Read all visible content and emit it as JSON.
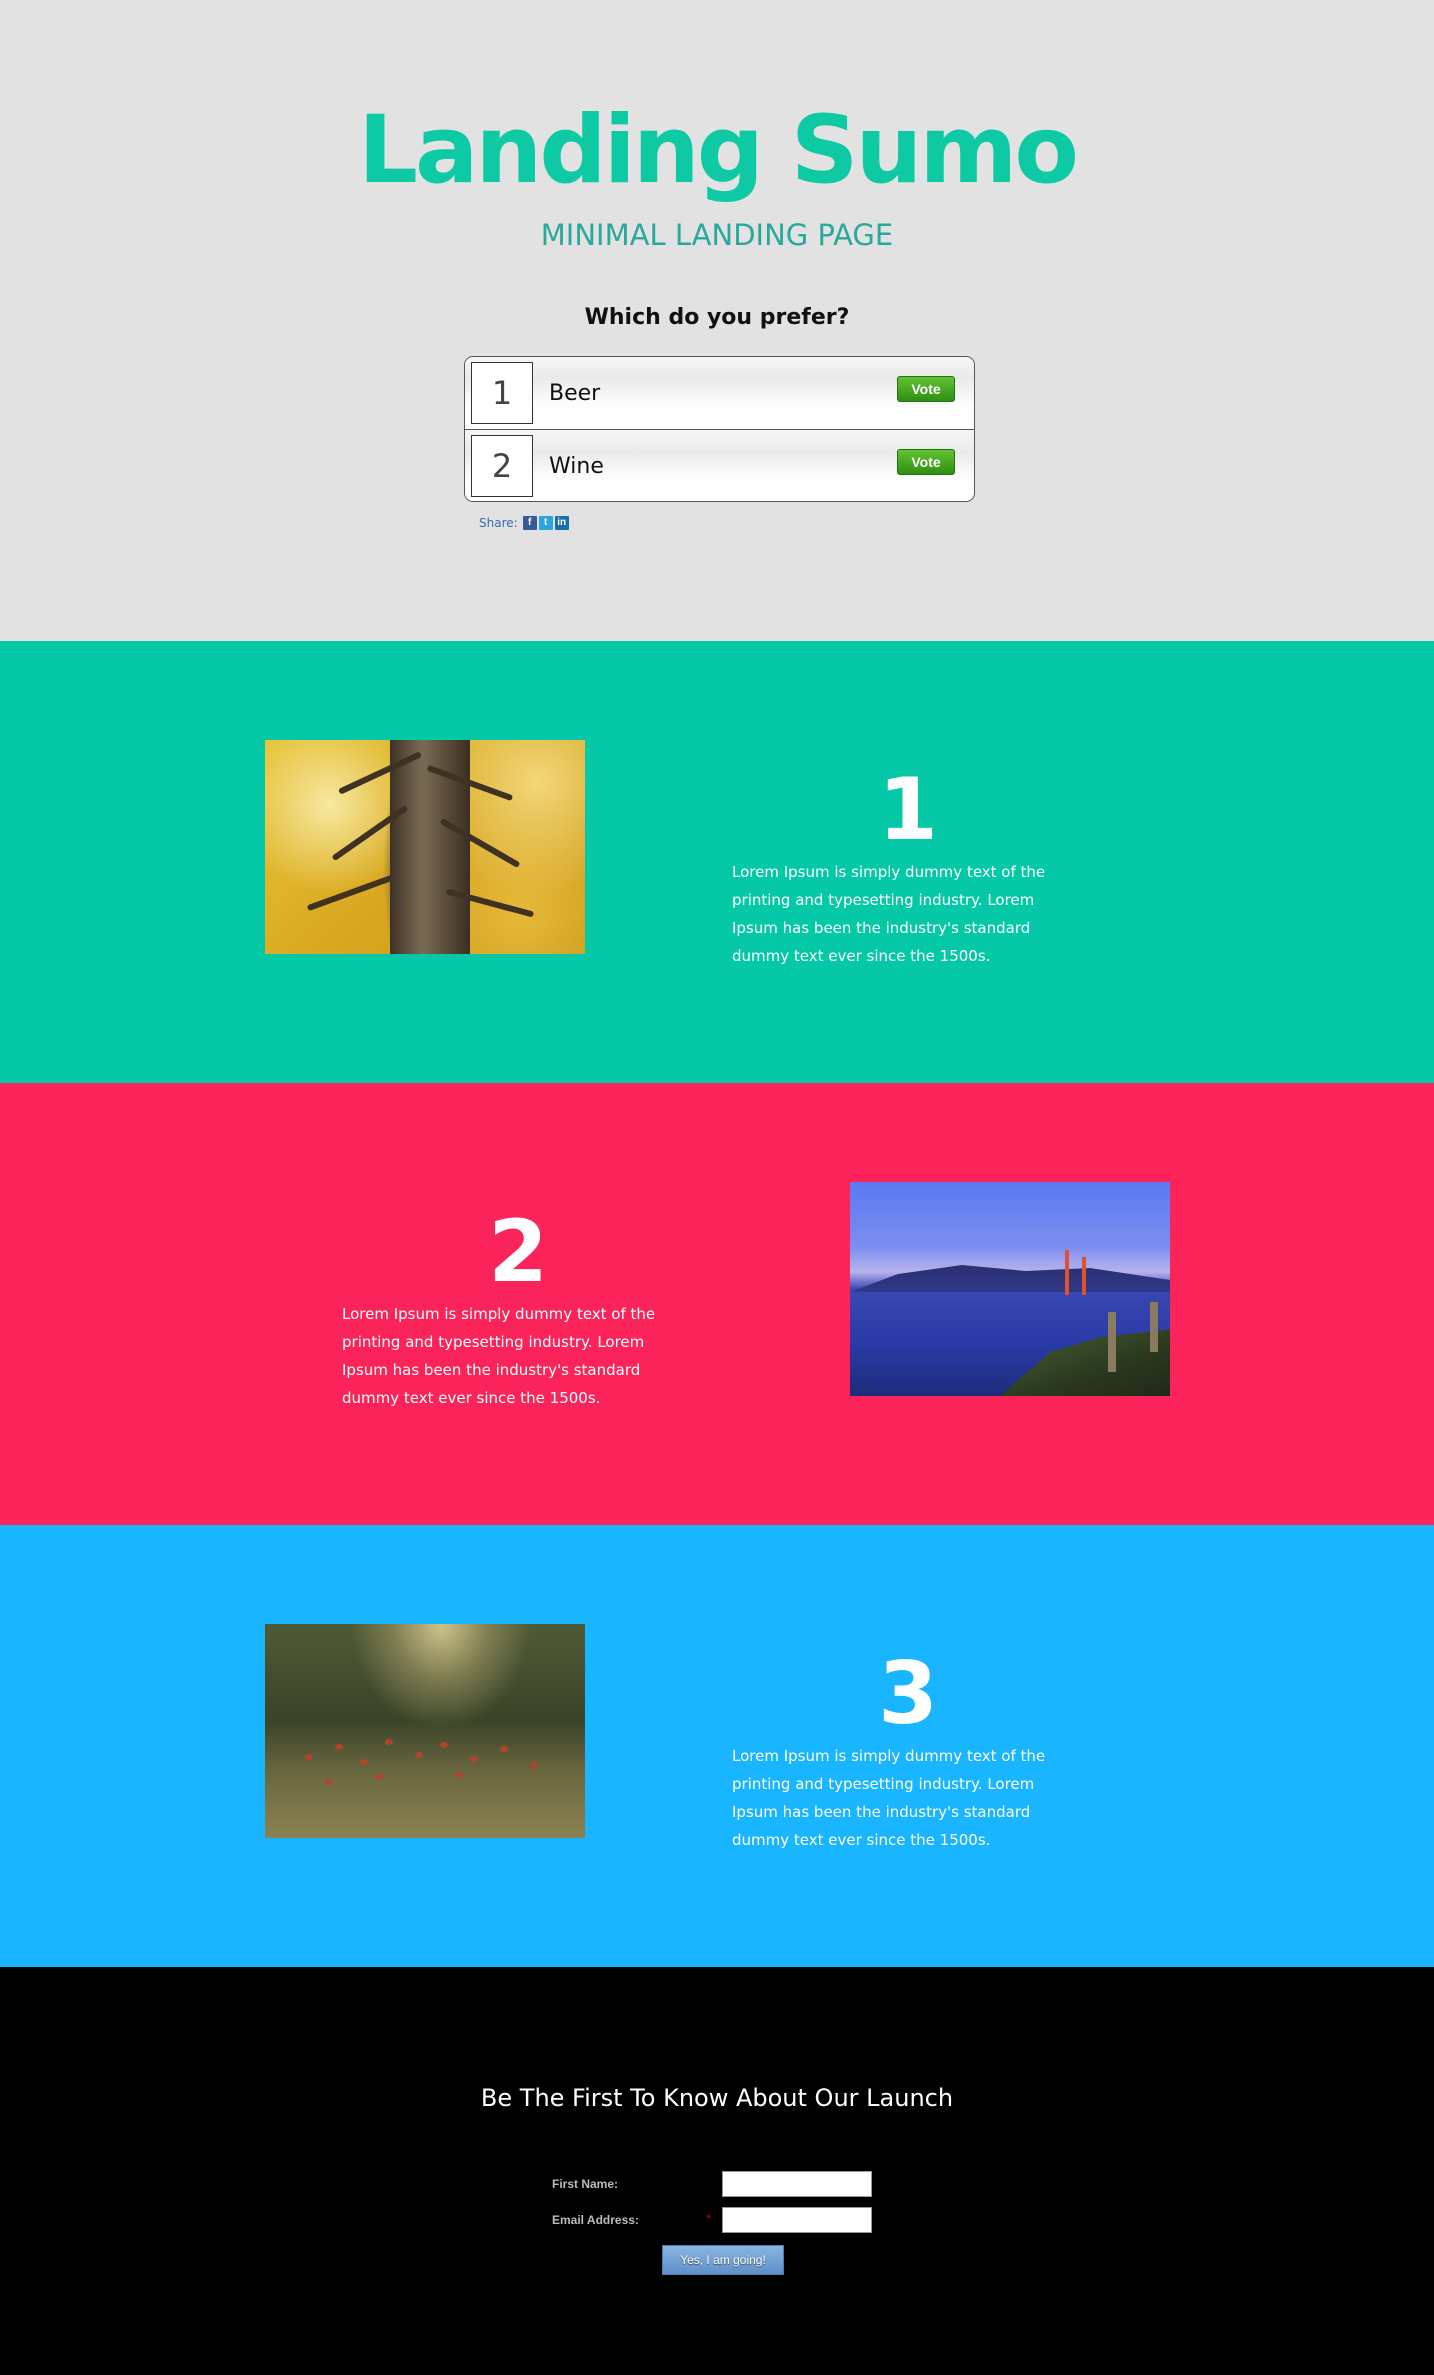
{
  "hero": {
    "title": "Landing Sumo",
    "subtitle": "MINIMAL LANDING PAGE"
  },
  "poll": {
    "question": "Which do you prefer?",
    "options": [
      {
        "number": "1",
        "label": "Beer",
        "vote_label": "Vote"
      },
      {
        "number": "2",
        "label": "Wine",
        "vote_label": "Vote"
      }
    ],
    "share_label": "Share:",
    "share_icons": [
      "facebook-icon",
      "twitter-icon",
      "linkedin-icon"
    ]
  },
  "features": [
    {
      "number": "1",
      "text": "Lorem Ipsum is simply dummy text of the printing and typesetting industry. Lorem Ipsum has been the industry's standard dummy text ever since the 1500s.",
      "bg_color": "#05c9a6"
    },
    {
      "number": "2",
      "text": "Lorem Ipsum is simply dummy text of the printing and typesetting industry. Lorem Ipsum has been the industry's standard dummy text ever since the 1500s.",
      "bg_color": "#fa245a"
    },
    {
      "number": "3",
      "text": "Lorem Ipsum is simply dummy text of the printing and typesetting industry. Lorem Ipsum has been the industry's standard dummy text ever since the 1500s.",
      "bg_color": "#19b5fe"
    }
  ],
  "signup": {
    "title": "Be The First To Know About Our Launch",
    "first_name_label": "First Name:",
    "first_name_value": "",
    "email_label": "Email Address:",
    "email_required_mark": "*",
    "email_value": "",
    "submit_label": "Yes, I am going!"
  },
  "colors": {
    "hero_bg": "#e2e2e2",
    "accent": "#0dcaa5",
    "vote_green": "#3fa71d",
    "signup_bg": "#000000"
  }
}
